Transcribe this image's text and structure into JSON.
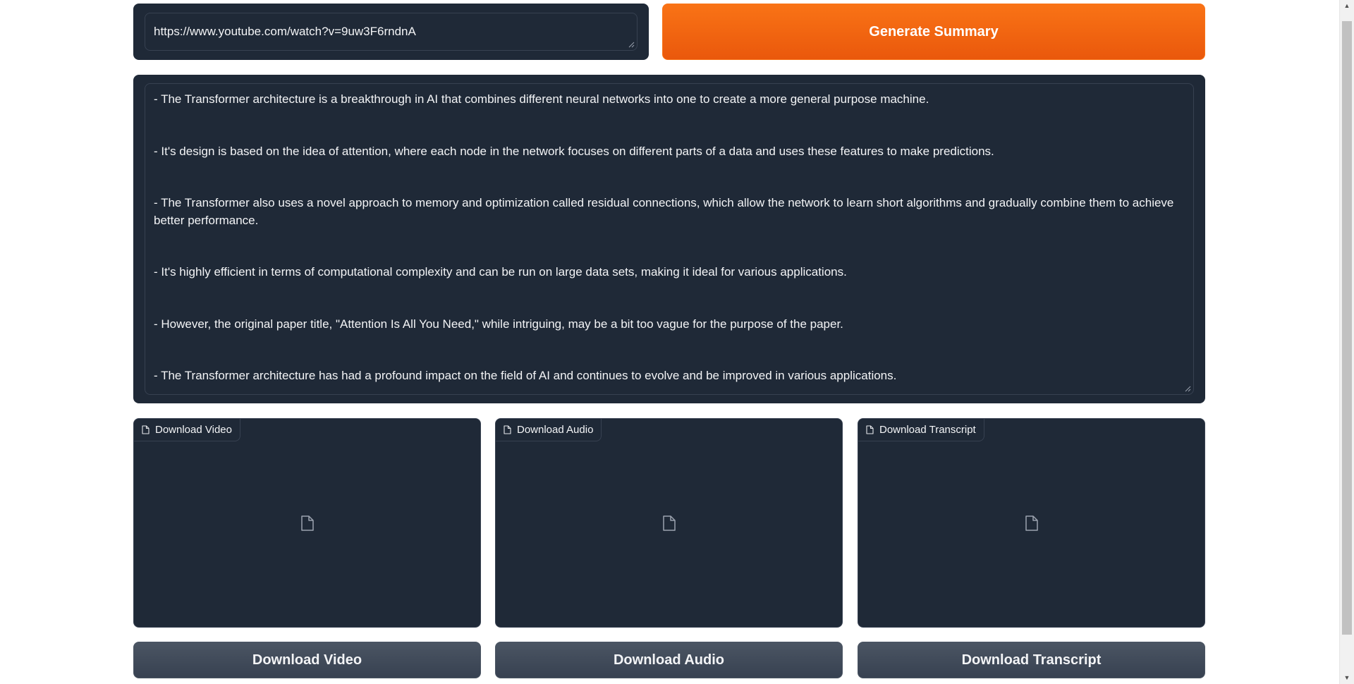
{
  "url_input": {
    "value": "https://www.youtube.com/watch?v=9uw3F6rndnA"
  },
  "generate_button": {
    "label": "Generate Summary"
  },
  "summary": {
    "lines": [
      "-  The Transformer architecture is a breakthrough in AI that combines different neural networks into one to create a more general purpose machine.",
      "-  It's design is based on the idea of attention, where each node in the network focuses on different parts of a data and uses these features to make predictions.",
      "-  The Transformer also uses a novel approach to memory and optimization called residual connections, which allow the network to learn short algorithms and gradually combine them to achieve better performance.",
      "-  It's highly efficient in terms of computational complexity and can be run on large data sets, making it ideal for various applications.",
      "-  However, the original paper title, \"Attention Is All You Need,\" while intriguing, may be a bit too vague for the purpose of the paper.",
      "-  The Transformer architecture has had a profound impact on the field of AI and continues to evolve and be improved in various applications."
    ]
  },
  "files": {
    "video_label": "Download Video",
    "audio_label": "Download Audio",
    "transcript_label": "Download Transcript"
  },
  "buttons": {
    "download_video": "Download Video",
    "download_audio": "Download Audio",
    "download_transcript": "Download Transcript"
  },
  "icons": {
    "file": "file-icon",
    "scroll_up": "scroll-up-arrow-icon",
    "scroll_down": "scroll-down-arrow-icon"
  },
  "colors": {
    "panel_bg": "#1f2937",
    "accent": "#f97316",
    "secondary_button": "#4b5563"
  }
}
